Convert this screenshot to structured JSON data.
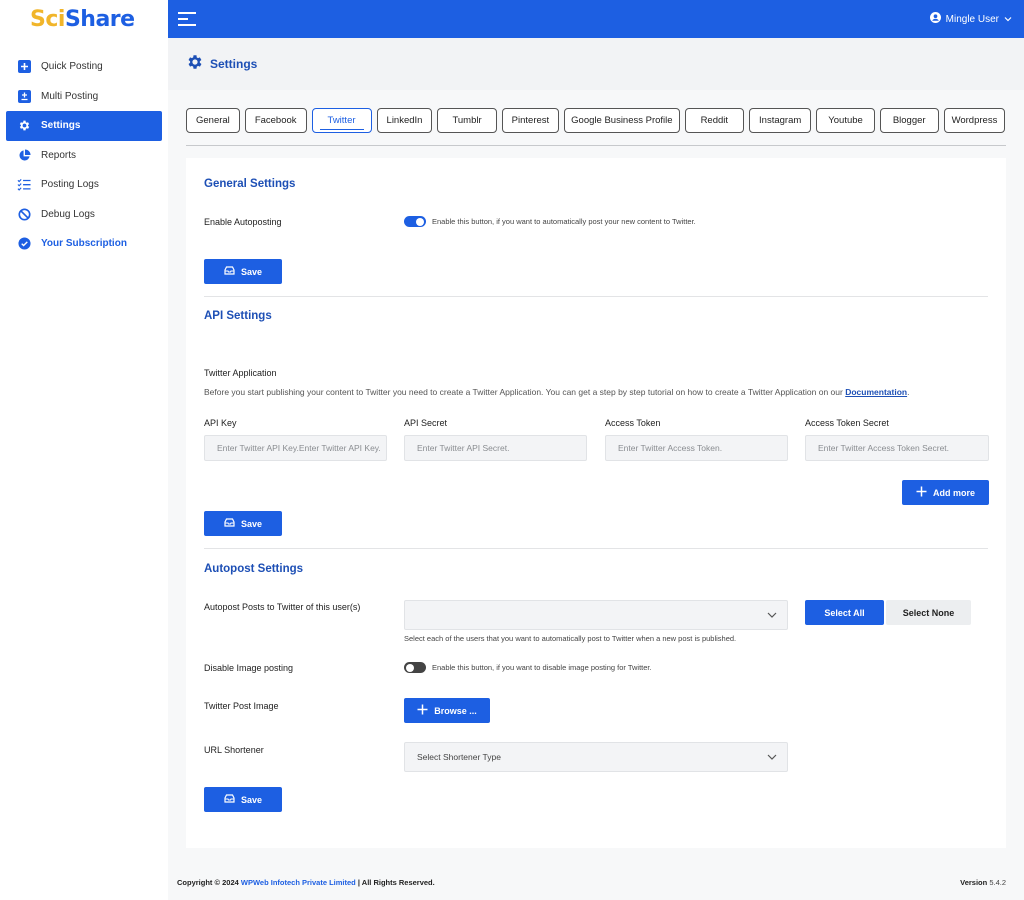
{
  "brand": {
    "logo_part1": "S",
    "logo_part2": "ci",
    "logo_part3": "Share",
    "primary_color": "#1d5fe2",
    "accent_color": "#f1b52a"
  },
  "sidebar": {
    "items": [
      {
        "label": "Quick Posting",
        "icon": "plus-square-icon"
      },
      {
        "label": "Multi Posting",
        "icon": "plus-minus-icon"
      },
      {
        "label": "Settings",
        "icon": "gear-icon",
        "active": true
      },
      {
        "label": "Reports",
        "icon": "pie-chart-icon"
      },
      {
        "label": "Posting Logs",
        "icon": "checklist-icon"
      },
      {
        "label": "Debug Logs",
        "icon": "ban-icon"
      },
      {
        "label": "Your Subscription",
        "icon": "check-badge-icon"
      }
    ]
  },
  "topbar": {
    "user_name": "Mingle User"
  },
  "page": {
    "title": "Settings"
  },
  "tabs": [
    "General",
    "Facebook",
    "Twitter",
    "LinkedIn",
    "Tumblr",
    "Pinterest",
    "Google Business Profile",
    "Reddit",
    "Instagram",
    "Youtube",
    "Blogger",
    "Wordpress"
  ],
  "active_tab": "Twitter",
  "general_settings": {
    "title": "General Settings",
    "enable_label": "Enable Autoposting",
    "enable_hint": "Enable this button, if you want to automatically post your new content to Twitter.",
    "enabled": true,
    "save_label": "Save"
  },
  "api_settings": {
    "title": "API Settings",
    "app_label": "Twitter Application",
    "description": "Before you start publishing your content to Twitter you need to create a Twitter Application. You can get a step by step tutorial on how to create a Twitter Application on our",
    "doc_link": "Documentation",
    "doc_suffix": ".",
    "fields": [
      {
        "label": "API Key",
        "placeholder": "Enter Twitter API Key.Enter Twitter API Key."
      },
      {
        "label": "API Secret",
        "placeholder": "Enter Twitter API Secret."
      },
      {
        "label": "Access Token",
        "placeholder": "Enter Twitter Access Token."
      },
      {
        "label": "Access Token Secret",
        "placeholder": "Enter Twitter Access Token Secret."
      }
    ],
    "add_more_label": "Add more",
    "save_label": "Save"
  },
  "autopost_settings": {
    "title": "Autopost Settings",
    "users_label": "Autopost Posts to Twitter of this user(s)",
    "users_hint": "Select each of the users that you want to automatically post to Twitter when a new post is published.",
    "select_all_label": "Select All",
    "select_none_label": "Select None",
    "disable_image_label": "Disable Image posting",
    "disable_image_hint": "Enable this button, if you want to disable image posting for Twitter.",
    "disable_image_enabled": false,
    "post_image_label": "Twitter Post Image",
    "browse_label": "Browse ...",
    "url_shortener_label": "URL Shortener",
    "url_shortener_value": "Select Shortener Type",
    "save_label": "Save"
  },
  "footer": {
    "copyright_prefix": "Copyright © 2024",
    "company": "WPWeb Infotech Private Limited",
    "copyright_suffix": "| All Rights Reserved.",
    "version_label": "Version",
    "version_value": "5.4.2"
  }
}
